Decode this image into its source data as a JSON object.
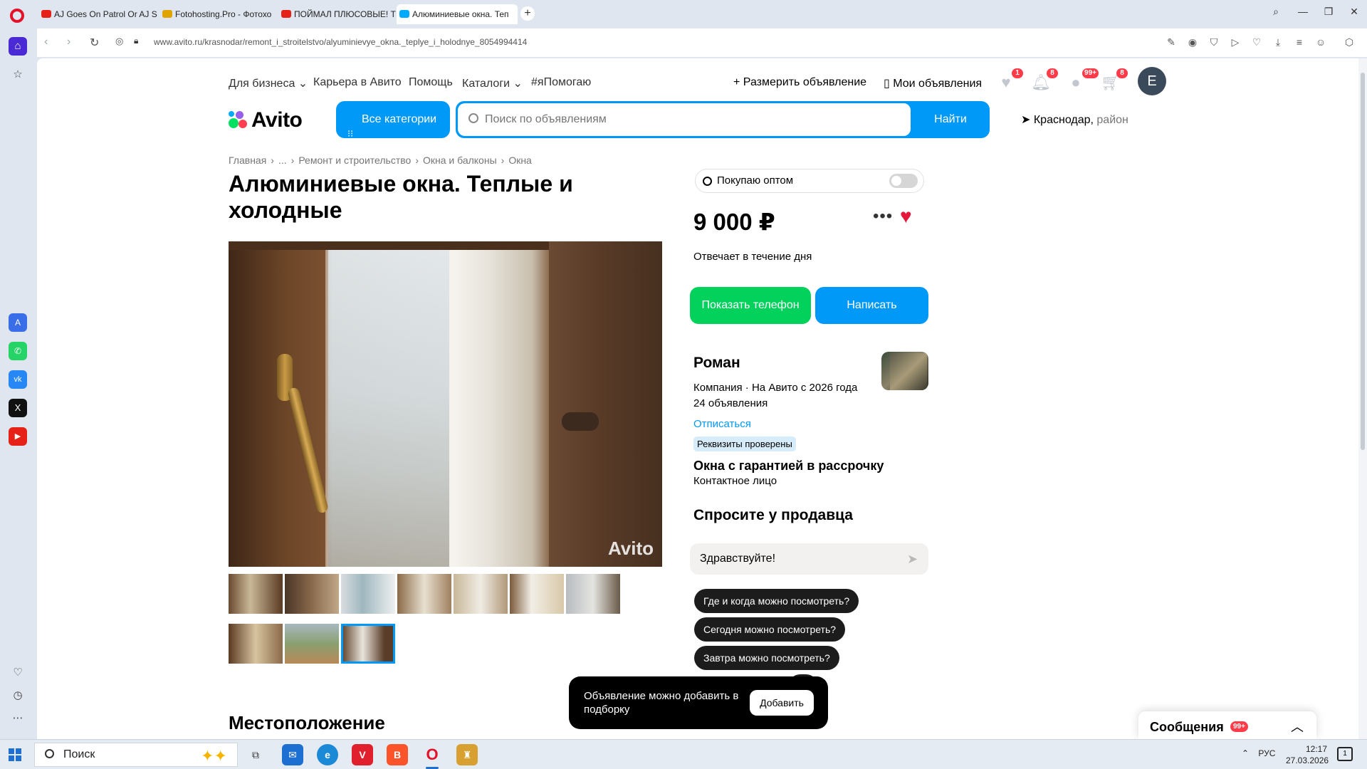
{
  "browser": {
    "tabs": [
      {
        "title": "AJ Goes On Patrol Or AJ S",
        "favicon_color": "#e62117"
      },
      {
        "title": "Fotohosting.Pro - Фотохо",
        "favicon_color": "#e0a400"
      },
      {
        "title": "ПОЙМАЛ ПЛЮСОВЫЕ! Т",
        "favicon_color": "#e62117"
      },
      {
        "title": "Алюминиевые окна. Теп",
        "favicon_color": "#00aaff"
      }
    ],
    "new_tab_label": "+",
    "url": "www.avito.ru/krasnodar/remont_i_stroitelstvo/alyuminievye_okna._teplye_i_holodnye_8054994414"
  },
  "header": {
    "links": [
      "Для бизнеса",
      "Карьера в Авито",
      "Помощь",
      "Каталоги",
      "#яПомогаю"
    ],
    "post_ad": "Размерить объявление",
    "my_ads": "Мои объявления",
    "badges": {
      "favorites": "1",
      "notifications": "8",
      "messages": "99+",
      "cart": "8"
    },
    "avatar_letter": "E",
    "logo_text": "Avito",
    "all_categories": "Все категории",
    "search_placeholder": "Поиск по объявлениям",
    "search_button": "Найти",
    "location_city": "Краснодар,",
    "location_area": "район"
  },
  "listing": {
    "breadcrumb": [
      "Главная",
      "›",
      "...",
      "›",
      "Ремонт и строительство",
      "›",
      "Окна и балконы",
      "›",
      "Окна"
    ],
    "title": "Алюминиевые окна. Теплые и холодные",
    "watermark": "Avito",
    "section_location": "Местоположение"
  },
  "sidebar_panel": {
    "wholesale_label": "Покупаю оптом",
    "price": "9 000 ₽",
    "response_time": "Отвечает в течение дня",
    "show_phone": "Показать телефон",
    "write": "Написать",
    "seller_name": "Роман",
    "seller_info": "Компания · На Авито с 2026 года",
    "seller_ads": "24 объявления",
    "unsubscribe": "Отписаться",
    "verified": "Реквизиты проверены",
    "company_name": "Окна с гарантией в рассрочку",
    "contact_role": "Контактное лицо",
    "ask_heading": "Спросите у продавца",
    "message_value": "Здравствуйте!",
    "quick_questions": [
      "Где и когда можно посмотреть?",
      "Сегодня можно посмотреть?",
      "Завтра можно посмотреть?",
      "й?"
    ]
  },
  "toast": {
    "text": "Объявление можно добавить в подборку",
    "button": "Добавить"
  },
  "messages_panel": {
    "title": "Сообщения",
    "badge": "99+"
  },
  "taskbar": {
    "search": "Поиск",
    "lang": "РУС",
    "time": "12:17",
    "date": "27.03.2026",
    "notify_count": "1"
  },
  "colors": {
    "brand_blue": "#0099f7",
    "brand_green": "#02d15c",
    "favorite_red": "#e3183c"
  }
}
